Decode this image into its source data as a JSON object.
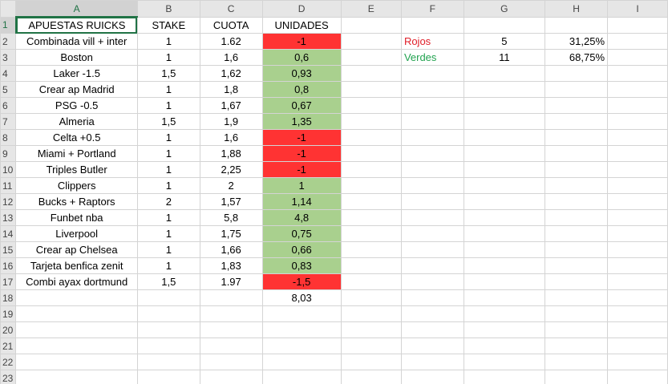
{
  "columns": [
    "A",
    "B",
    "C",
    "D",
    "E",
    "F",
    "G",
    "H",
    "I"
  ],
  "row_numbers": [
    "1",
    "2",
    "3",
    "4",
    "5",
    "6",
    "7",
    "8",
    "9",
    "10",
    "11",
    "12",
    "13",
    "14",
    "15",
    "16",
    "17",
    "18",
    "19",
    "20",
    "21",
    "22",
    "23"
  ],
  "headers": {
    "A": "APUESTAS RUICKS",
    "B": "STAKE",
    "C": "CUOTA",
    "D": "UNIDADES"
  },
  "bets": [
    {
      "name": "Combinada vill + inter",
      "stake": "1",
      "cuota": "1.62",
      "unidades": "-1",
      "result": "red"
    },
    {
      "name": "Boston",
      "stake": "1",
      "cuota": "1,6",
      "unidades": "0,6",
      "result": "green"
    },
    {
      "name": "Laker -1.5",
      "stake": "1,5",
      "cuota": "1,62",
      "unidades": "0,93",
      "result": "green"
    },
    {
      "name": "Crear ap Madrid",
      "stake": "1",
      "cuota": "1,8",
      "unidades": "0,8",
      "result": "green"
    },
    {
      "name": "PSG -0.5",
      "stake": "1",
      "cuota": "1,67",
      "unidades": "0,67",
      "result": "green"
    },
    {
      "name": "Almeria",
      "stake": "1,5",
      "cuota": "1,9",
      "unidades": "1,35",
      "result": "green"
    },
    {
      "name": "Celta +0.5",
      "stake": "1",
      "cuota": "1,6",
      "unidades": "-1",
      "result": "red"
    },
    {
      "name": "Miami + Portland",
      "stake": "1",
      "cuota": "1,88",
      "unidades": "-1",
      "result": "red"
    },
    {
      "name": "Triples Butler",
      "stake": "1",
      "cuota": "2,25",
      "unidades": "-1",
      "result": "red"
    },
    {
      "name": "Clippers",
      "stake": "1",
      "cuota": "2",
      "unidades": "1",
      "result": "green"
    },
    {
      "name": "Bucks + Raptors",
      "stake": "2",
      "cuota": "1,57",
      "unidades": "1,14",
      "result": "green"
    },
    {
      "name": "Funbet nba",
      "stake": "1",
      "cuota": "5,8",
      "unidades": "4,8",
      "result": "green"
    },
    {
      "name": "Liverpool",
      "stake": "1",
      "cuota": "1,75",
      "unidades": "0,75",
      "result": "green"
    },
    {
      "name": "Crear ap Chelsea",
      "stake": "1",
      "cuota": "1,66",
      "unidades": "0,66",
      "result": "green"
    },
    {
      "name": "Tarjeta benfica zenit",
      "stake": "1",
      "cuota": "1,83",
      "unidades": "0,83",
      "result": "green"
    },
    {
      "name": "Combi ayax dortmund",
      "stake": "1,5",
      "cuota": "1.97",
      "unidades": "-1,5",
      "result": "red"
    }
  ],
  "total_unidades": "8,03",
  "summary": {
    "rojos": {
      "label": "Rojos",
      "count": "5",
      "pct": "31,25%"
    },
    "verdes": {
      "label": "Verdes",
      "count": "11",
      "pct": "68,75%"
    }
  },
  "colors": {
    "loss_fill": "#ff3333",
    "win_fill": "#a9d08e",
    "rojos_text": "#e0202a",
    "verdes_text": "#22a350",
    "selection": "#217346"
  }
}
